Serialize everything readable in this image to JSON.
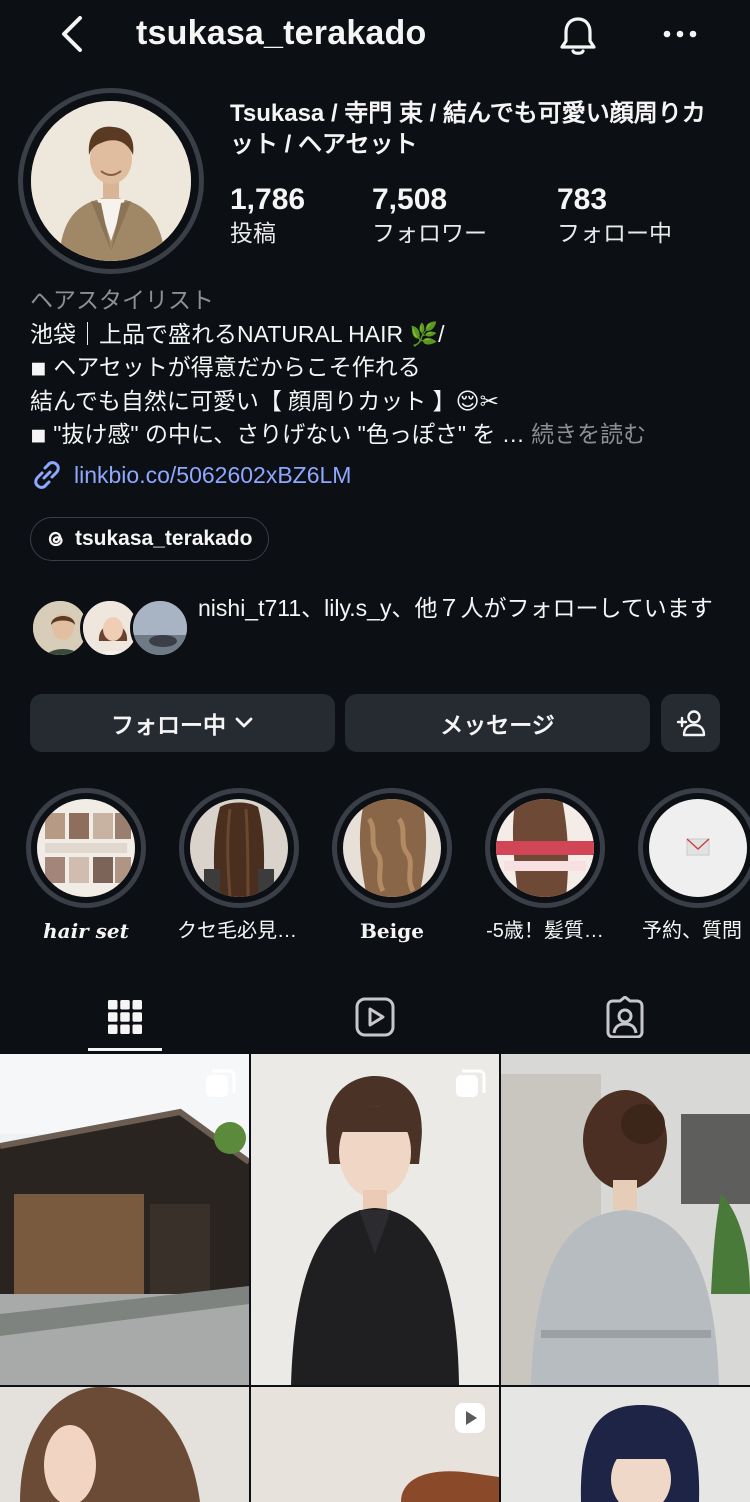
{
  "header": {
    "username": "tsukasa_terakado"
  },
  "profile": {
    "display_name": "Tsukasa / 寺門 束 / 結んでも可愛い顔周りカット / ヘアセット",
    "stats": [
      {
        "value": "1,786",
        "label": "投稿"
      },
      {
        "value": "7,508",
        "label": "フォロワー"
      },
      {
        "value": "783",
        "label": "フォロー中"
      }
    ],
    "category": "ヘアスタイリスト",
    "bio_lines": [
      "池袋｜上品で盛れるNATURAL HAIR 🌿/",
      "◾ ヘアセットが得意だからこそ作れる",
      "結んでも自然に可愛い【 顔周りカット 】😌✂",
      "◾ \"抜け感\" の中に、さりげない \"色っぽさ\" を …"
    ],
    "more_label": "続きを読む",
    "link": "linkbio.co/5062602xBZ6LM",
    "threads_handle": "tsukasa_terakado",
    "followed_by_text": "nishi_t711、lily.s_y、他７人がフォローしています"
  },
  "buttons": {
    "following": "フォロー中",
    "message": "メッセージ"
  },
  "highlights": [
    {
      "label": "hair set"
    },
    {
      "label": "クセ毛必見👀"
    },
    {
      "label": "Beige"
    },
    {
      "label": "-5歳！髪質…"
    },
    {
      "label": "予約、質問"
    }
  ],
  "icons": {
    "back": "chevron-left-icon",
    "notifications": "bell-icon",
    "more": "more-horizontal-icon",
    "link": "link-icon",
    "threads": "threads-icon",
    "dropdown": "chevron-down-icon",
    "add_person": "add-person-icon",
    "grid_tab": "grid-icon",
    "reels_tab": "reels-icon",
    "tagged_tab": "tagged-icon"
  },
  "colors": {
    "background": "#0c0f14",
    "button_bg": "#262a31",
    "link": "#8ea8ff",
    "muted": "#8e8e93"
  }
}
